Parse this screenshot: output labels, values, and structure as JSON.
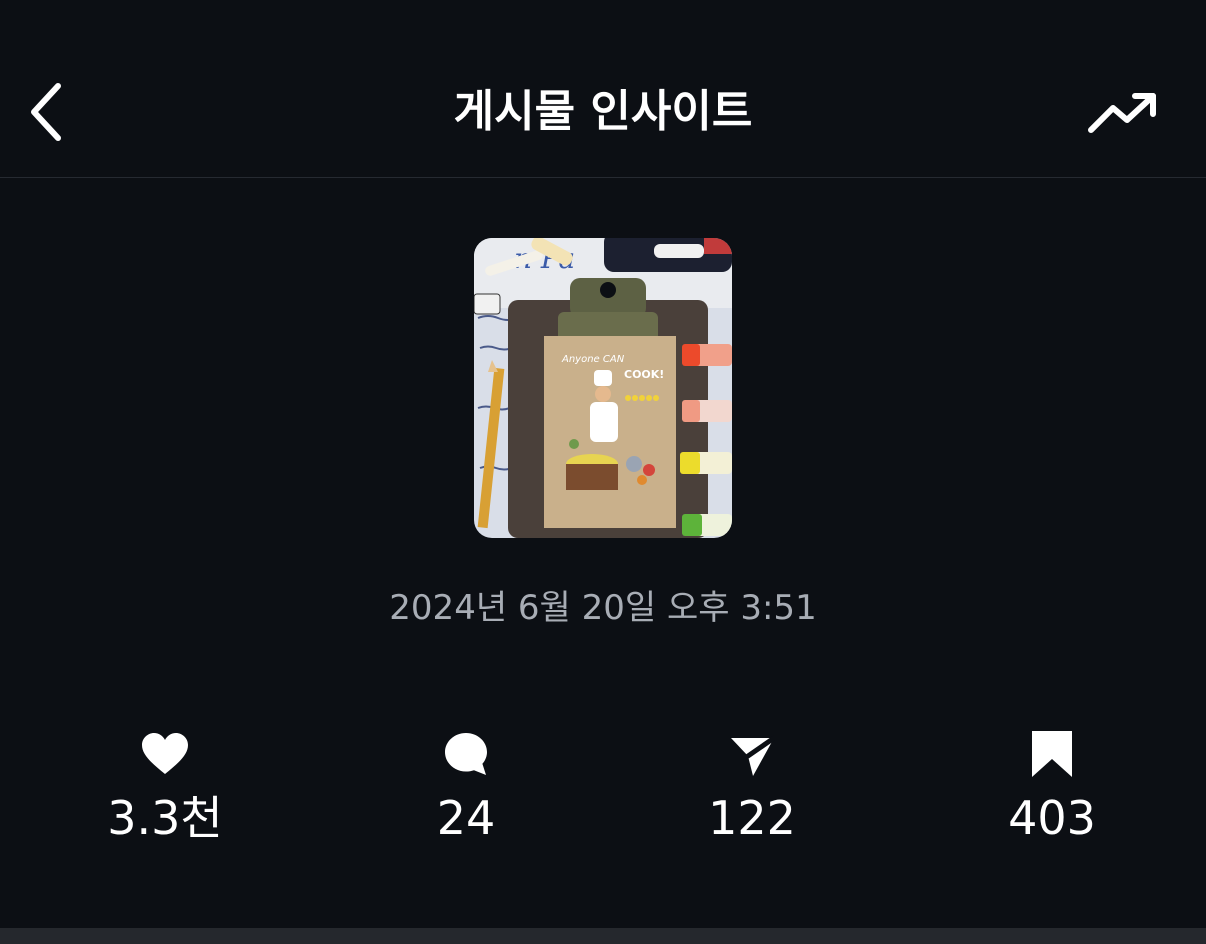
{
  "header": {
    "title": "게시물 인사이트",
    "back_icon": "chevron-left-icon",
    "trend_icon": "trending-up-icon"
  },
  "post": {
    "thumbnail_alt": "Clipboard illustration: Anyone can cook",
    "thumbnail_text": {
      "headline": "Anyone CAN",
      "subline": "COOK!"
    },
    "timestamp": "2024년 6월 20일 오후 3:51"
  },
  "stats": [
    {
      "icon": "heart-icon",
      "value": "3.3천"
    },
    {
      "icon": "comment-icon",
      "value": "24"
    },
    {
      "icon": "share-icon",
      "value": "122"
    },
    {
      "icon": "bookmark-icon",
      "value": "403"
    }
  ],
  "colors": {
    "background": "#0c0f14",
    "text": "#ffffff",
    "muted": "#a8adb5",
    "divider": "#262a31"
  }
}
